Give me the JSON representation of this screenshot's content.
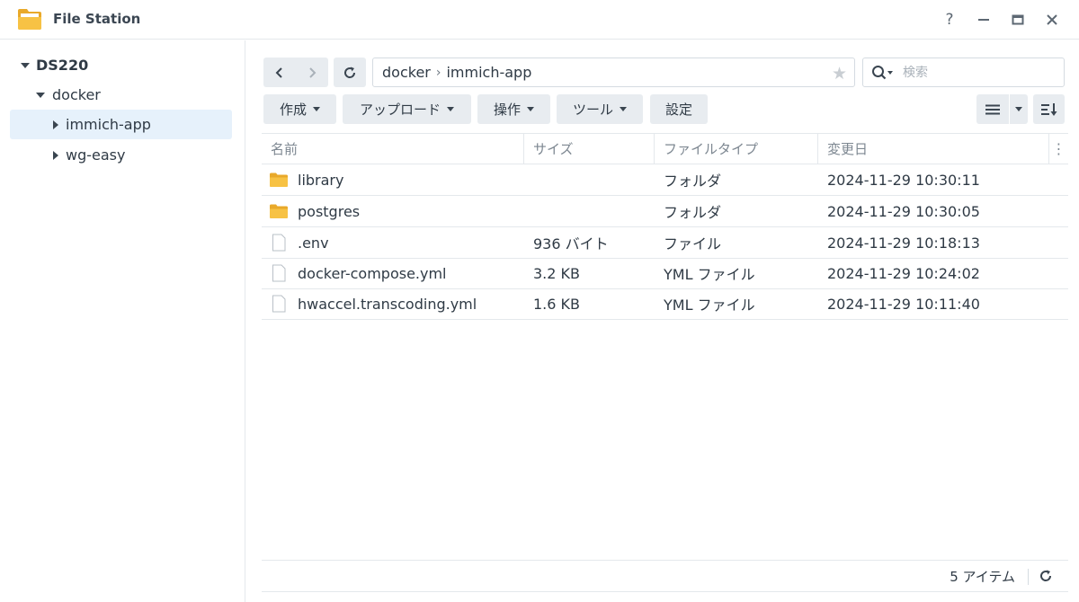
{
  "window": {
    "title": "File Station",
    "icon": "folder-app-icon",
    "controls": [
      "help-icon",
      "minimize-icon",
      "maximize-icon",
      "close-icon"
    ],
    "help_label": "?"
  },
  "sidebar": {
    "root": "DS220",
    "items": [
      {
        "label": "docker",
        "expanded": true
      },
      {
        "label": "immich-app",
        "selected": true
      },
      {
        "label": "wg-easy"
      }
    ]
  },
  "path": {
    "segments": [
      "docker",
      "immich-app"
    ],
    "separator": "›"
  },
  "search": {
    "placeholder": "検索"
  },
  "toolbar": {
    "create": "作成",
    "upload": "アップロード",
    "action": "操作",
    "tools": "ツール",
    "settings": "設定"
  },
  "table": {
    "headers": {
      "name": "名前",
      "size": "サイズ",
      "type": "ファイルタイプ",
      "modified": "変更日"
    },
    "rows": [
      {
        "icon": "folder-icon",
        "name": "library",
        "size": "",
        "type": "フォルダ",
        "modified": "2024-11-29 10:30:11"
      },
      {
        "icon": "folder-icon",
        "name": "postgres",
        "size": "",
        "type": "フォルダ",
        "modified": "2024-11-29 10:30:05"
      },
      {
        "icon": "file-icon",
        "name": ".env",
        "size": "936 バイト",
        "type": "ファイル",
        "modified": "2024-11-29 10:18:13"
      },
      {
        "icon": "file-icon",
        "name": "docker-compose.yml",
        "size": "3.2 KB",
        "type": "YML ファイル",
        "modified": "2024-11-29 10:24:02"
      },
      {
        "icon": "file-icon",
        "name": "hwaccel.transcoding.yml",
        "size": "1.6 KB",
        "type": "YML ファイル",
        "modified": "2024-11-29 10:11:40"
      }
    ]
  },
  "status": {
    "count": "5 アイテム"
  },
  "colors": {
    "folder": "#f7c244",
    "folder_dark": "#e9a92a",
    "selection": "#e6f1fb",
    "button_bg": "#e8ecf0",
    "border": "#e4e8ec"
  }
}
